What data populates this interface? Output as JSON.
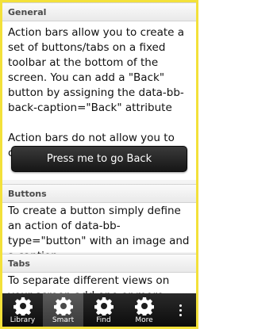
{
  "sections": {
    "general": {
      "header": "General",
      "text1": "Action bars allow you to create a set of buttons/tabs on a fixed toolbar at the bottom of the screen. You can add a \"Back\" button by assigning the data-bb-back-caption=\"Back\" attribute",
      "text2": "Action bars do not allow you to combine a back button with tabs",
      "button_label": "Press me to go Back"
    },
    "buttons": {
      "header": "Buttons",
      "text": "To create a button simply define an action of data-bb-type=\"button\" with an image and a caption."
    },
    "tabs": {
      "header": "Tabs",
      "text": "To separate different views on your screen add one or more tabs. Tabs should be"
    }
  },
  "action_bar": {
    "tabs": [
      {
        "label": "Library",
        "icon": "gear-icon",
        "active": false
      },
      {
        "label": "Smart",
        "icon": "gear-icon",
        "active": true
      },
      {
        "label": "Find",
        "icon": "gear-icon",
        "active": false
      },
      {
        "label": "More",
        "icon": "gear-icon",
        "active": false
      }
    ],
    "overflow_icon": "overflow-menu-icon"
  },
  "colors": {
    "frame": "#f3e13a",
    "tabbar": "#141414",
    "active_tab": "#4a4a4a",
    "button": "#1f1f1f"
  }
}
